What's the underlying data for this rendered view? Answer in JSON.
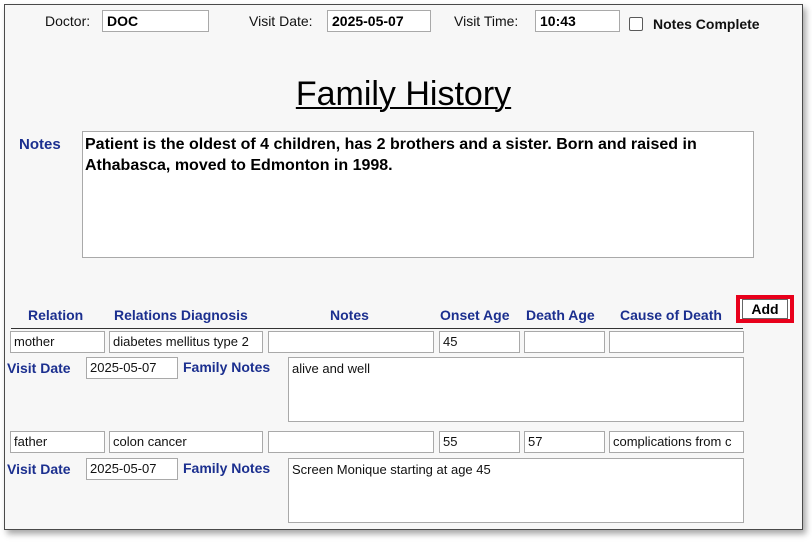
{
  "header": {
    "doctor_label": "Doctor:",
    "doctor_value": "DOC",
    "visit_date_label": "Visit Date:",
    "visit_date_value": "2025-05-07",
    "visit_time_label": "Visit Time:",
    "visit_time_value": "10:43",
    "notes_complete_label": "Notes Complete",
    "notes_complete_checked": false
  },
  "page_title": "Family History",
  "notes": {
    "label": "Notes",
    "value": "Patient is the oldest of 4 children, has 2 brothers and a sister. Born and raised in Athabasca, moved to Edmonton in 1998."
  },
  "table": {
    "columns": [
      "Relation",
      "Relations Diagnosis",
      "Notes",
      "Onset Age",
      "Death Age",
      "Cause of Death"
    ],
    "add_label": "Add",
    "visit_date_label": "Visit Date",
    "family_notes_label": "Family Notes",
    "rows": [
      {
        "relation": "mother",
        "diagnosis": "diabetes mellitus type 2",
        "notes": "",
        "onset_age": "45",
        "death_age": "",
        "cause_of_death": "",
        "visit_date": "2025-05-07",
        "family_notes": "alive and well"
      },
      {
        "relation": "father",
        "diagnosis": "colon cancer",
        "notes": "",
        "onset_age": "55",
        "death_age": "57",
        "cause_of_death": "complications from c",
        "visit_date": "2025-05-07",
        "family_notes": "Screen Monique starting at age 45"
      }
    ]
  },
  "colors": {
    "label_blue": "#1b2f8f",
    "highlight_red": "#e8001b"
  }
}
